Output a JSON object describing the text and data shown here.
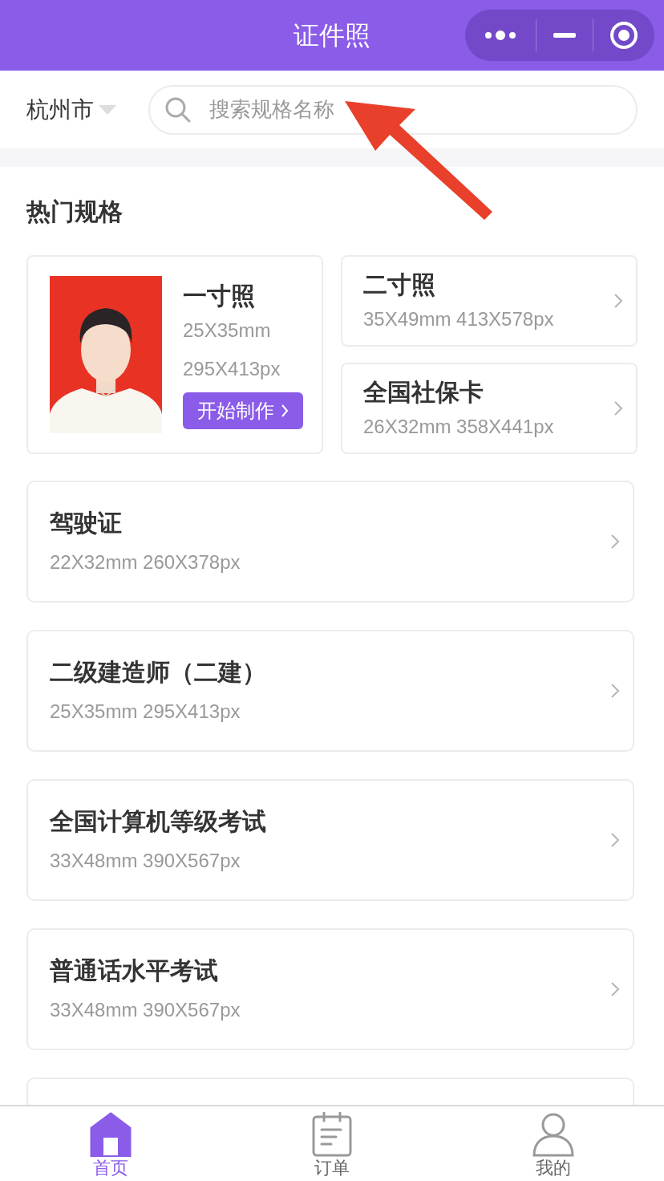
{
  "header": {
    "title": "证件照"
  },
  "location": {
    "city": "杭州市"
  },
  "search": {
    "placeholder": "搜索规格名称"
  },
  "section": {
    "title": "热门规格"
  },
  "featured": {
    "name": "一寸照",
    "size_mm": "25X35mm",
    "size_px": "295X413px",
    "button": "开始制作"
  },
  "side_specs": [
    {
      "name": "二寸照",
      "size": "35X49mm 413X578px"
    },
    {
      "name": "全国社保卡",
      "size": "26X32mm 358X441px"
    }
  ],
  "specs": [
    {
      "name": "驾驶证",
      "size": "22X32mm 260X378px"
    },
    {
      "name": "二级建造师（二建）",
      "size": "25X35mm 295X413px"
    },
    {
      "name": "全国计算机等级考试",
      "size": "33X48mm 390X567px"
    },
    {
      "name": "普通话水平考试",
      "size": "33X48mm 390X567px"
    }
  ],
  "tabs": [
    {
      "label": "首页",
      "selected": true,
      "kind": "home"
    },
    {
      "label": "订单",
      "selected": false,
      "kind": "orders"
    },
    {
      "label": "我的",
      "selected": false,
      "kind": "profile"
    }
  ]
}
